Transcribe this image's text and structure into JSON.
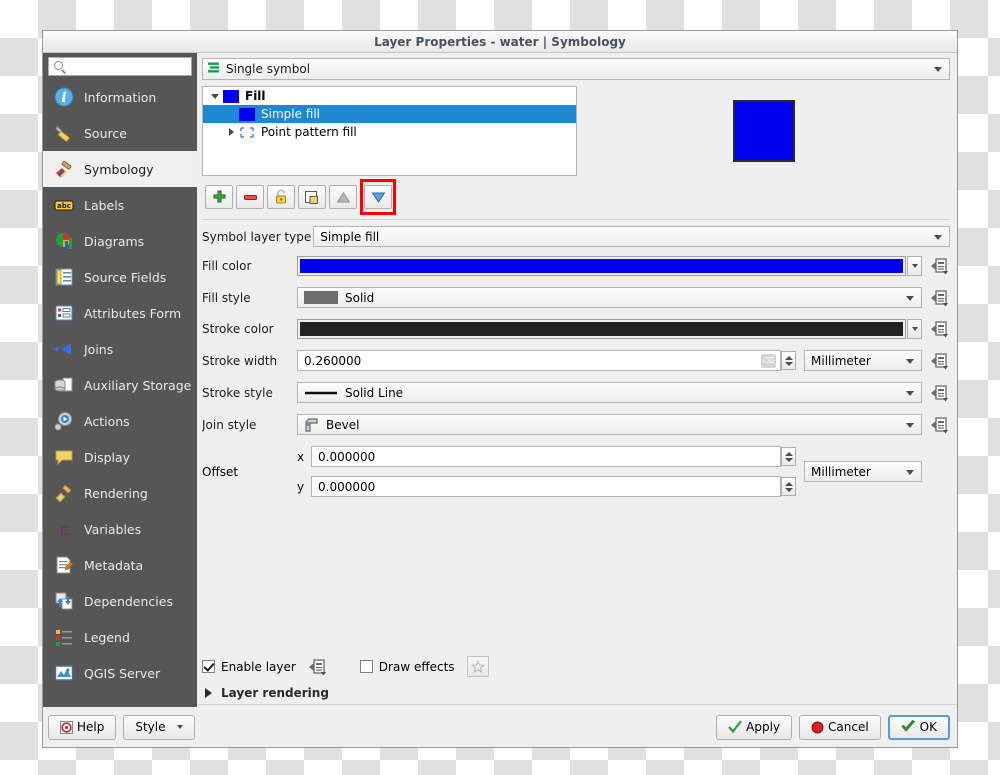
{
  "window": {
    "title": "Layer Properties - water | Symbology"
  },
  "sidebar": {
    "search_placeholder": "",
    "search_value": "",
    "items": [
      {
        "label": "Information",
        "icon": "information-icon",
        "selected": false
      },
      {
        "label": "Source",
        "icon": "source-icon",
        "selected": false
      },
      {
        "label": "Symbology",
        "icon": "symbology-icon",
        "selected": true
      },
      {
        "label": "Labels",
        "icon": "labels-icon",
        "selected": false
      },
      {
        "label": "Diagrams",
        "icon": "diagrams-icon",
        "selected": false
      },
      {
        "label": "Source Fields",
        "icon": "source-fields-icon",
        "selected": false
      },
      {
        "label": "Attributes Form",
        "icon": "attributes-form-icon",
        "selected": false
      },
      {
        "label": "Joins",
        "icon": "joins-icon",
        "selected": false
      },
      {
        "label": "Auxiliary Storage",
        "icon": "auxiliary-storage-icon",
        "selected": false
      },
      {
        "label": "Actions",
        "icon": "actions-icon",
        "selected": false
      },
      {
        "label": "Display",
        "icon": "display-icon",
        "selected": false
      },
      {
        "label": "Rendering",
        "icon": "rendering-icon",
        "selected": false
      },
      {
        "label": "Variables",
        "icon": "variables-icon",
        "selected": false
      },
      {
        "label": "Metadata",
        "icon": "metadata-icon",
        "selected": false
      },
      {
        "label": "Dependencies",
        "icon": "dependencies-icon",
        "selected": false
      },
      {
        "label": "Legend",
        "icon": "legend-icon",
        "selected": false
      },
      {
        "label": "QGIS Server",
        "icon": "qgis-server-icon",
        "selected": false
      }
    ]
  },
  "renderer": {
    "value": "Single symbol",
    "icon": "single-symbol-icon"
  },
  "symbol_tree": {
    "rows": [
      {
        "label": "Fill",
        "level": 0,
        "twisty": "down",
        "swatch": "blue",
        "selected": false,
        "bold": true
      },
      {
        "label": "Simple fill",
        "level": 1,
        "twisty": "none",
        "swatch": "blue",
        "selected": true,
        "bold": false
      },
      {
        "label": "Point pattern fill",
        "level": 1,
        "twisty": "right",
        "swatch": "pattern",
        "selected": false,
        "bold": false
      }
    ]
  },
  "preview": {
    "fill_color": "#0000ee",
    "stroke_color": "#2b2b2b"
  },
  "symbol_toolbar": {
    "buttons": [
      {
        "name": "add-symbol-layer",
        "icon": "plus-icon",
        "enabled": true,
        "highlighted": false
      },
      {
        "name": "remove-symbol-layer",
        "icon": "minus-icon",
        "enabled": true,
        "highlighted": false
      },
      {
        "name": "lock-layer-colors",
        "icon": "lock-icon",
        "enabled": true,
        "highlighted": false
      },
      {
        "name": "duplicate-symbol-layer",
        "icon": "duplicate-icon",
        "enabled": true,
        "highlighted": false
      },
      {
        "name": "move-up",
        "icon": "triangle-up-icon",
        "enabled": false,
        "highlighted": false
      },
      {
        "name": "move-down",
        "icon": "triangle-down-icon",
        "enabled": true,
        "highlighted": true
      }
    ]
  },
  "form": {
    "symbol_layer_type": {
      "label": "Symbol layer type",
      "value": "Simple fill"
    },
    "fill_color": {
      "label": "Fill color",
      "value": "#0000ee"
    },
    "fill_style": {
      "label": "Fill style",
      "value": "Solid",
      "swatch": "#6e6e6e"
    },
    "stroke_color": {
      "label": "Stroke color",
      "value": "#232323"
    },
    "stroke_width": {
      "label": "Stroke width",
      "value": "0.260000",
      "unit": "Millimeter"
    },
    "stroke_style": {
      "label": "Stroke style",
      "value": "Solid Line"
    },
    "join_style": {
      "label": "Join style",
      "value": "Bevel"
    },
    "offset": {
      "label": "Offset",
      "x_tag": "x",
      "y_tag": "y",
      "x_value": "0.000000",
      "y_value": "0.000000",
      "unit": "Millimeter"
    }
  },
  "bottom": {
    "enable_layer": {
      "label": "Enable layer",
      "checked": true
    },
    "draw_effects": {
      "label": "Draw effects",
      "checked": false
    },
    "layer_rendering": {
      "label": "Layer rendering",
      "expanded": false
    }
  },
  "buttons": {
    "help": "Help",
    "style": "Style",
    "apply": "Apply",
    "cancel": "Cancel",
    "ok": "OK"
  }
}
